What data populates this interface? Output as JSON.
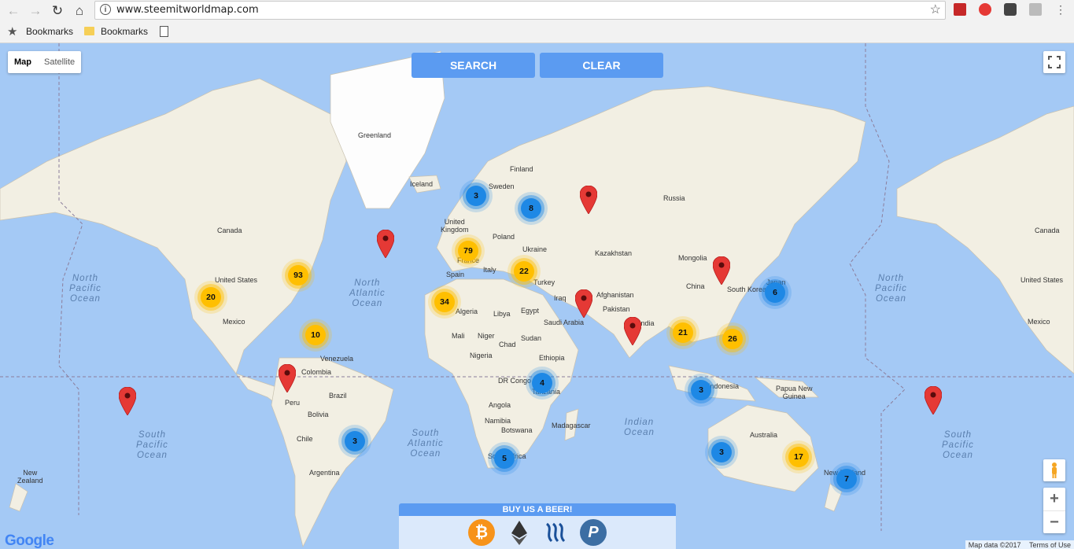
{
  "browser": {
    "url": "www.steemitworldmap.com",
    "bookmarks": [
      "Bookmarks",
      "Bookmarks"
    ]
  },
  "map": {
    "type_control": {
      "map": "Map",
      "satellite": "Satellite"
    },
    "buttons": {
      "search": "SEARCH",
      "clear": "CLEAR"
    },
    "labels": {
      "greenland": "Greenland",
      "iceland": "Iceland",
      "finland": "Finland",
      "sweden": "Sweden",
      "united_kingdom": "United\nKingdom",
      "poland": "Poland",
      "ukraine": "Ukraine",
      "france": "France",
      "spain": "Spain",
      "italy": "Italy",
      "turkey": "Turkey",
      "russia": "Russia",
      "kazakhstan": "Kazakhstan",
      "mongolia": "Mongolia",
      "china": "China",
      "south_korea": "South Korea",
      "japan": "Japan",
      "afghanistan": "Afghanistan",
      "pakistan": "Pakistan",
      "iraq": "Iraq",
      "saudi_arabia": "Saudi Arabia",
      "india": "India",
      "algeria": "Algeria",
      "libya": "Libya",
      "egypt": "Egypt",
      "mali": "Mali",
      "niger": "Niger",
      "chad": "Chad",
      "sudan": "Sudan",
      "nigeria": "Nigeria",
      "ethiopia": "Ethiopia",
      "dr_congo": "DR Congo",
      "tanzania": "Tanzania",
      "angola": "Angola",
      "namibia": "Namibia",
      "botswana": "Botswana",
      "south_africa": "South Africa",
      "madagascar": "Madagascar",
      "canada_l": "Canada",
      "united_states_l": "United States",
      "mexico_l": "Mexico",
      "canada_r": "Canada",
      "united_states_r": "United States",
      "mexico_r": "Mexico",
      "venezuela": "Venezuela",
      "colombia": "Colombia",
      "peru": "Peru",
      "brazil": "Brazil",
      "bolivia": "Bolivia",
      "chile": "Chile",
      "argentina": "Argentina",
      "indonesia": "Indonesia",
      "papua_new_guinea": "Papua New\nGuinea",
      "australia": "Australia",
      "new_zealand_l": "New\nZealand",
      "new_zealand_r": "New Zealand"
    },
    "oceans": {
      "north_pacific_l": "North\nPacific\nOcean",
      "north_atlantic": "North\nAtlantic\nOcean",
      "north_pacific_r": "North\nPacific\nOcean",
      "south_pacific_l": "South\nPacific\nOcean",
      "south_atlantic": "South\nAtlantic\nOcean",
      "indian": "Indian\nOcean",
      "south_pacific_r": "South\nPacific\nOcean"
    },
    "clusters": [
      {
        "count": "93",
        "color": "yellow"
      },
      {
        "count": "20",
        "color": "yellow"
      },
      {
        "count": "10",
        "color": "yellow"
      },
      {
        "count": "79",
        "color": "yellow"
      },
      {
        "count": "34",
        "color": "yellow"
      },
      {
        "count": "22",
        "color": "yellow"
      },
      {
        "count": "21",
        "color": "yellow"
      },
      {
        "count": "26",
        "color": "yellow"
      },
      {
        "count": "17",
        "color": "yellow"
      },
      {
        "count": "3",
        "color": "blue"
      },
      {
        "count": "8",
        "color": "blue"
      },
      {
        "count": "6",
        "color": "blue"
      },
      {
        "count": "4",
        "color": "blue"
      },
      {
        "count": "3",
        "color": "blue"
      },
      {
        "count": "3",
        "color": "blue"
      },
      {
        "count": "5",
        "color": "blue"
      },
      {
        "count": "3",
        "color": "blue"
      },
      {
        "count": "7",
        "color": "blue"
      }
    ],
    "beer_box": {
      "title": "BUY US A BEER!"
    },
    "google_logo": "Google",
    "attribution": {
      "data": "Map data ©2017",
      "terms": "Terms of Use"
    }
  },
  "colors": {
    "water": "#a4c9f5",
    "land": "#f2efe3",
    "cluster_yellow": "#ffbf00",
    "cluster_blue": "#1e88e5",
    "pin_red": "#e53935",
    "button_blue": "#5b9bf1"
  }
}
